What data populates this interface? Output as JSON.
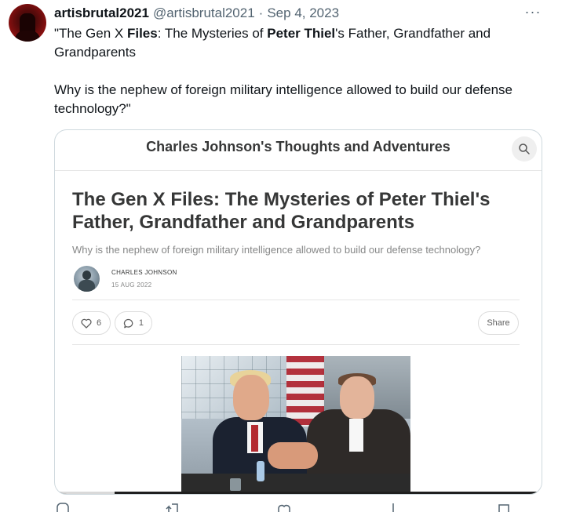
{
  "tweet": {
    "display_name": "artisbrutal2021",
    "handle": "@artisbrutal2021",
    "separator": "·",
    "date": "Sep 4, 2023",
    "more_label": "···",
    "text": {
      "line1_prefix": "\"The Gen X ",
      "line1_bold1": "Files",
      "line1_mid": ": The Mysteries of ",
      "line1_bold2": "Peter Thiel",
      "line1_suffix": "'s Father, Grandfather and Grandparents",
      "line2": "Why is the nephew of foreign military intelligence allowed to build our defense technology?\""
    }
  },
  "card": {
    "blog_title": "Charles Johnson's Thoughts and Adventures",
    "post_title": "The Gen X Files: The Mysteries of Peter Thiel's Father, Grandfather and Grandparents",
    "subtitle": "Why is the nephew of foreign military intelligence allowed to build our defense technology?",
    "author_name": "CHARLES JOHNSON",
    "author_date": "15 AUG 2022",
    "likes": "6",
    "comments": "1",
    "share_label": "Share"
  },
  "icons": {
    "search": "search-icon",
    "heart": "heart-icon",
    "comment": "comment-bubble-icon"
  },
  "colors": {
    "secondary_text": "#536471",
    "card_border": "#cfd9de"
  }
}
